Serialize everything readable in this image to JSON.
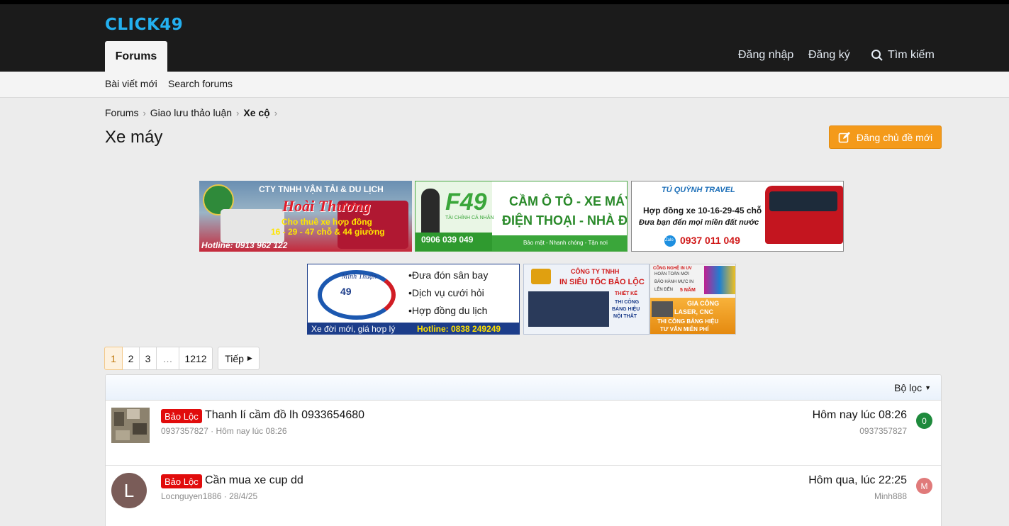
{
  "header": {
    "logo": "CLICK49",
    "tab_forums": "Forums",
    "login": "Đăng nhập",
    "register": "Đăng ký",
    "search": "Tìm kiếm"
  },
  "subnav": {
    "new_posts": "Bài viết mới",
    "search_forums": "Search forums"
  },
  "breadcrumb": [
    "Forums",
    "Giao lưu thảo luận",
    "Xe cộ"
  ],
  "page": {
    "title": "Xe máy",
    "new_thread": "Đăng chủ đề mới"
  },
  "banners": {
    "b1": {
      "line1": "CTY TNHH VẬN TẢI & DU LỊCH",
      "brand": "Hoài Thương",
      "line2": "Cho thuê xe hợp đồng",
      "line3": "16 - 29 - 47 chỗ & 44 giường",
      "hotline": "Hotline: 0913 962 122"
    },
    "b2": {
      "brand": "F49",
      "sub": "TÀI CHÍNH CÁ NHÂN",
      "line1": "CẦM Ô TÔ - XE MÁY",
      "line2": "ĐIỆN THOẠI - NHÀ ĐẤT",
      "phone": "0906 039 049",
      "tag": "Bảo mật - Nhanh chóng - Tận nơi"
    },
    "b3": {
      "brand": "TÚ QUỲNH TRAVEL",
      "line1": "Hợp đồng xe 10-16-29-45 chỗ",
      "line2": "Đưa bạn đến mọi miền đất nước",
      "zalo": "Zalo",
      "phone": "0937 011 049"
    },
    "b4": {
      "brand": "Minh Thuận",
      "num": "49",
      "item1": "•Đưa đón sân bay",
      "item2": "•Dịch vụ cưới hỏi",
      "item3": "•Hợp đồng du lịch",
      "slogan": "Xe đời mới, giá hợp lý",
      "hotline": "Hotline: 0838 249249"
    },
    "b5": {
      "line1": "CÔNG TY TNHH",
      "line2": "IN SIÊU TỐC BẢO LỘC",
      "side1": "THIẾT KẾ",
      "side2": "THI CÔNG",
      "side3": "BẢNG HIỆU",
      "side4": "NỘI THẤT"
    },
    "b6": {
      "line1": "CÔNG NGHỆ IN UV",
      "line2": "HOÀN TOÀN MỚI",
      "line3": "BẢO HÀNH MỰC IN",
      "line4": "LÊN ĐẾN",
      "years": "5 NĂM",
      "line5": "GIA CÔNG",
      "line6": "LASER, CNC",
      "line7": "THI CÔNG BẢNG HIỆU",
      "line8": "TƯ VẤN MIỄN PHÍ"
    }
  },
  "pagination": {
    "pages": [
      "1",
      "2",
      "3",
      "…",
      "1212"
    ],
    "next": "Tiếp"
  },
  "list": {
    "filter": "Bộ lọc",
    "threads": [
      {
        "prefix": "Bảo Lộc",
        "title": "Thanh lí cầm đồ lh 0933654680",
        "author": "0937357827",
        "date": "Hôm nay lúc 08:26",
        "last_date": "Hôm nay lúc 08:26",
        "last_user": "0937357827",
        "last_avatar": "0",
        "last_avatar_color": "#1e8a3c"
      },
      {
        "prefix": "Bảo Lộc",
        "title": "Cần mua xe cup dd",
        "author": "Locnguyen1886",
        "date": "28/4/25",
        "avatar": "L",
        "last_date": "Hôm qua, lúc 22:25",
        "last_user": "Minh888",
        "last_avatar": "M",
        "last_avatar_color": "#e07a7a"
      }
    ]
  },
  "colors": {
    "accent": "#f49a1a",
    "logo": "#23b0f0",
    "prefix": "#e10c0c"
  }
}
